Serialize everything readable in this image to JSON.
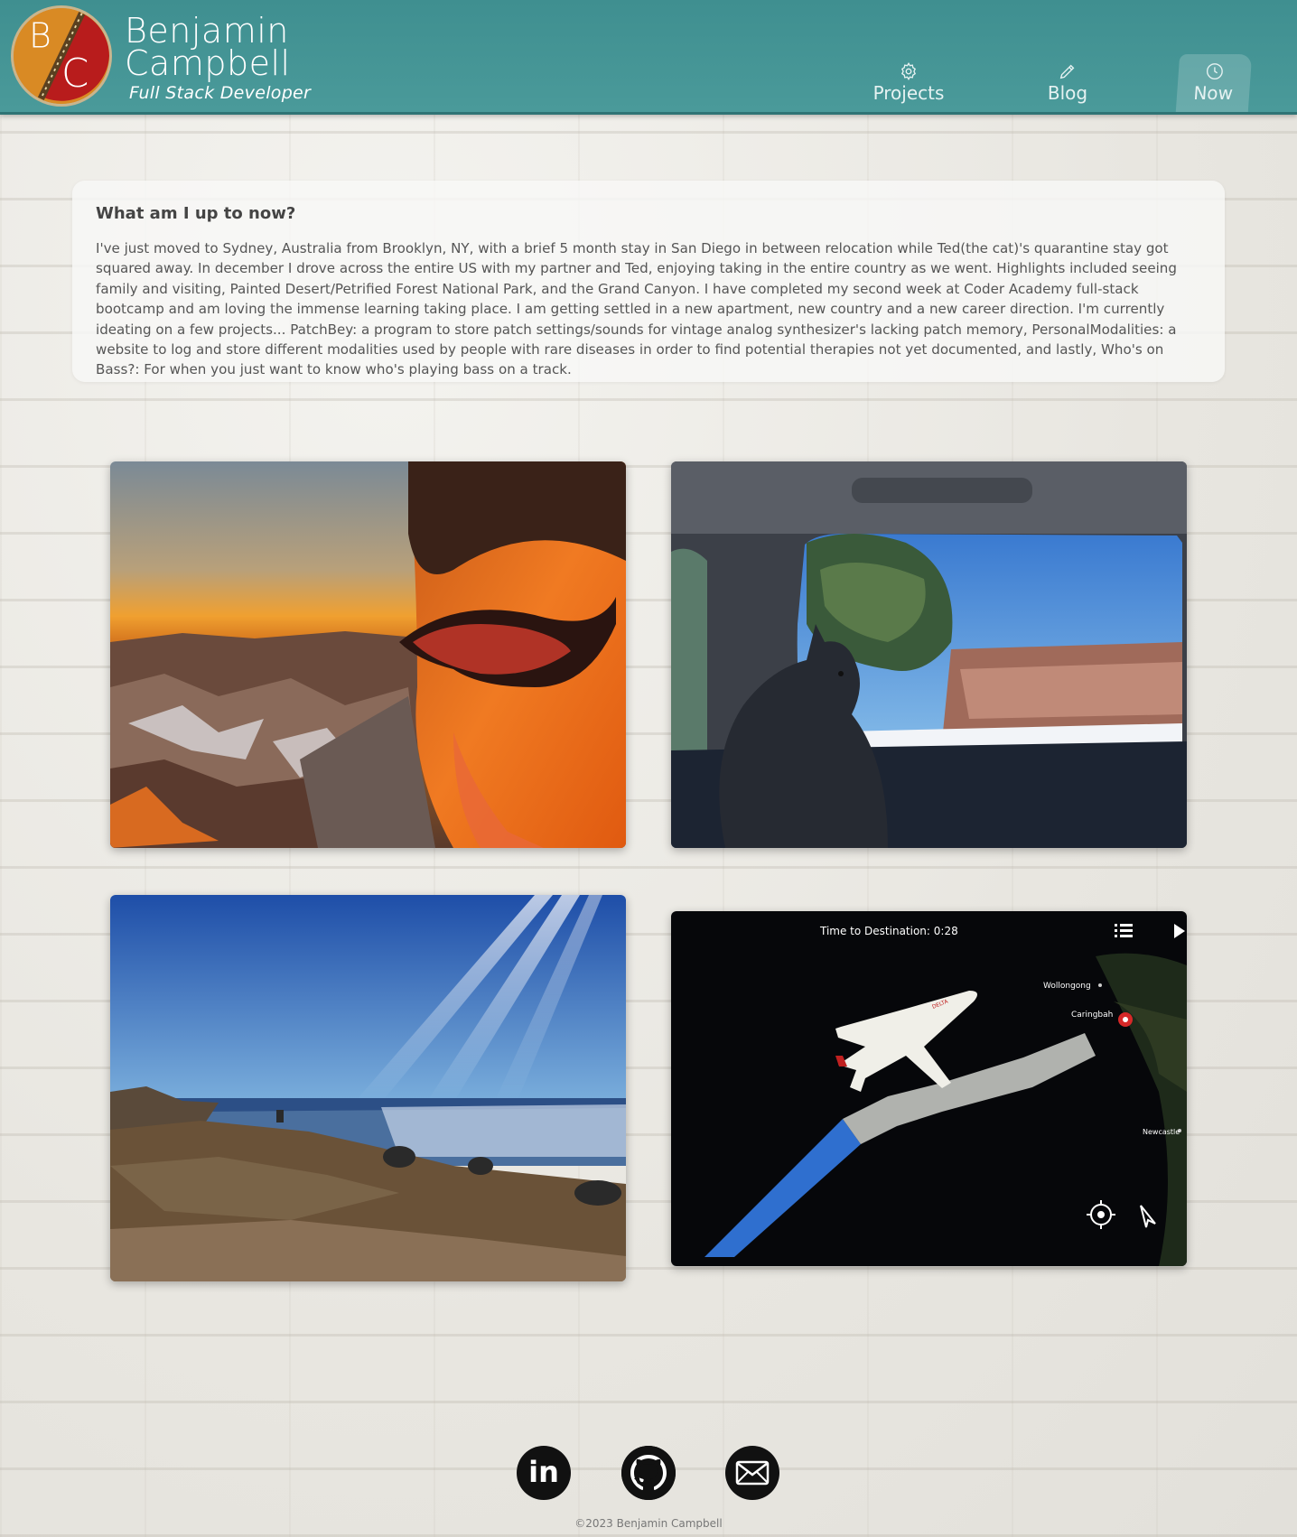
{
  "header": {
    "logo_initials": [
      "B",
      "C"
    ],
    "name_line1": "Benjamin",
    "name_line2": "Campbell",
    "role": "Full Stack Developer"
  },
  "nav": {
    "items": [
      {
        "label": "Projects",
        "icon": "gear-icon",
        "active": false
      },
      {
        "label": "Blog",
        "icon": "pencil-icon",
        "active": false
      },
      {
        "label": "Now",
        "icon": "clock-icon",
        "active": true
      }
    ]
  },
  "now": {
    "heading": "What am I up to now?",
    "body": "I've just moved to Sydney, Australia from Brooklyn, NY, with a brief 5 month stay in San Diego in between relocation while Ted(the cat)'s quarantine stay got squared away. In december I drove across the entire US with my partner and Ted, enjoying taking in the entire country as we went. Highlights included seeing family and visiting, Painted Desert/Petrified Forest National Park, and the Grand Canyon. I have completed my second week at Coder Academy full-stack bootcamp and am loving the immense learning taking place. I am getting settled in a new apartment, new country and a new career direction. I'm currently ideating on a few projects... PatchBey: a program to store patch settings/sounds for vintage analog synthesizer's lacking patch memory, PersonalModalities: a website to log and store different modalities used by people with rare diseases in order to find potential therapies not yet documented, and lastly, Who's on Bass?: For when you just want to know who's playing bass on a track."
  },
  "photos": {
    "flight_map": {
      "time_to_destination": "Time to Destination: 0:28",
      "places": [
        "Wollongong",
        "Caringbah",
        "Newcastle"
      ],
      "airline_mark": "DELTA"
    }
  },
  "footer": {
    "social": [
      {
        "name": "linkedin-icon",
        "glyph": "in"
      },
      {
        "name": "github-icon"
      },
      {
        "name": "email-icon"
      }
    ],
    "copyright": "©2023 Benjamin Campbell"
  },
  "colors": {
    "header": "#4a9a9a",
    "logo_orange": "#d98a24",
    "logo_red": "#b81c1c"
  }
}
